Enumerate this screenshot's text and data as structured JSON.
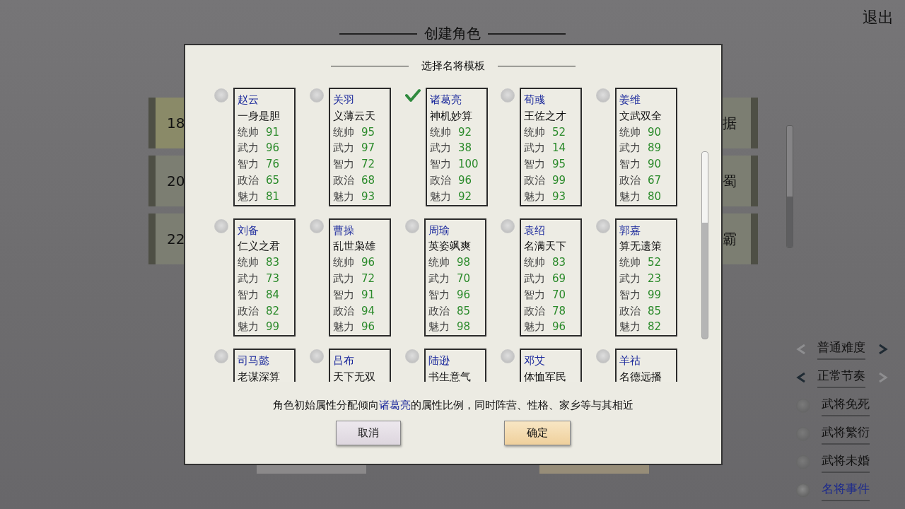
{
  "screen_title": "创建角色",
  "exit": "退出",
  "left_cards": [
    {
      "label": "18",
      "selected": true
    },
    {
      "label": "20",
      "selected": false
    },
    {
      "label": "22",
      "selected": false
    }
  ],
  "right_cards": [
    {
      "label": "据",
      "selected": false
    },
    {
      "label": "蜀",
      "selected": false
    },
    {
      "label": "霸",
      "selected": false
    }
  ],
  "settings": [
    {
      "kind": "stepper",
      "label": "普通难度",
      "prev_enabled": false,
      "next_enabled": true
    },
    {
      "kind": "stepper",
      "label": "正常节奏",
      "prev_enabled": true,
      "next_enabled": false
    },
    {
      "kind": "toggle",
      "label": "武将免死",
      "on": false
    },
    {
      "kind": "toggle",
      "label": "武将繁衍",
      "on": false
    },
    {
      "kind": "toggle",
      "label": "武将未婚",
      "on": false
    },
    {
      "kind": "toggle",
      "label": "名将事件",
      "on": true
    }
  ],
  "dialog": {
    "title": "选择名将模板",
    "generals": [
      {
        "name": "赵云",
        "motto": "一身是胆",
        "selected": false,
        "stats": [
          {
            "label": "统帅",
            "value": "91"
          },
          {
            "label": "武力",
            "value": "96"
          },
          {
            "label": "智力",
            "value": "76"
          },
          {
            "label": "政治",
            "value": "65"
          },
          {
            "label": "魅力",
            "value": "81"
          }
        ]
      },
      {
        "name": "关羽",
        "motto": "义薄云天",
        "selected": false,
        "stats": [
          {
            "label": "统帅",
            "value": "95"
          },
          {
            "label": "武力",
            "value": "97"
          },
          {
            "label": "智力",
            "value": "72"
          },
          {
            "label": "政治",
            "value": "68"
          },
          {
            "label": "魅力",
            "value": "93"
          }
        ]
      },
      {
        "name": "诸葛亮",
        "motto": "神机妙算",
        "selected": true,
        "stats": [
          {
            "label": "统帅",
            "value": "92"
          },
          {
            "label": "武力",
            "value": "38"
          },
          {
            "label": "智力",
            "value": "100"
          },
          {
            "label": "政治",
            "value": "96"
          },
          {
            "label": "魅力",
            "value": "92"
          }
        ]
      },
      {
        "name": "荀彧",
        "motto": "王佐之才",
        "selected": false,
        "stats": [
          {
            "label": "统帅",
            "value": "52"
          },
          {
            "label": "武力",
            "value": "14"
          },
          {
            "label": "智力",
            "value": "95"
          },
          {
            "label": "政治",
            "value": "99"
          },
          {
            "label": "魅力",
            "value": "93"
          }
        ]
      },
      {
        "name": "姜维",
        "motto": "文武双全",
        "selected": false,
        "stats": [
          {
            "label": "统帅",
            "value": "90"
          },
          {
            "label": "武力",
            "value": "89"
          },
          {
            "label": "智力",
            "value": "90"
          },
          {
            "label": "政治",
            "value": "67"
          },
          {
            "label": "魅力",
            "value": "80"
          }
        ]
      },
      {
        "name": "刘备",
        "motto": "仁义之君",
        "selected": false,
        "stats": [
          {
            "label": "统帅",
            "value": "83"
          },
          {
            "label": "武力",
            "value": "73"
          },
          {
            "label": "智力",
            "value": "84"
          },
          {
            "label": "政治",
            "value": "82"
          },
          {
            "label": "魅力",
            "value": "99"
          }
        ]
      },
      {
        "name": "曹操",
        "motto": "乱世枭雄",
        "selected": false,
        "stats": [
          {
            "label": "统帅",
            "value": "96"
          },
          {
            "label": "武力",
            "value": "72"
          },
          {
            "label": "智力",
            "value": "91"
          },
          {
            "label": "政治",
            "value": "94"
          },
          {
            "label": "魅力",
            "value": "96"
          }
        ]
      },
      {
        "name": "周瑜",
        "motto": "英姿飒爽",
        "selected": false,
        "stats": [
          {
            "label": "统帅",
            "value": "98"
          },
          {
            "label": "武力",
            "value": "70"
          },
          {
            "label": "智力",
            "value": "96"
          },
          {
            "label": "政治",
            "value": "85"
          },
          {
            "label": "魅力",
            "value": "98"
          }
        ]
      },
      {
        "name": "袁绍",
        "motto": "名满天下",
        "selected": false,
        "stats": [
          {
            "label": "统帅",
            "value": "83"
          },
          {
            "label": "武力",
            "value": "69"
          },
          {
            "label": "智力",
            "value": "70"
          },
          {
            "label": "政治",
            "value": "78"
          },
          {
            "label": "魅力",
            "value": "96"
          }
        ]
      },
      {
        "name": "郭嘉",
        "motto": "算无遗策",
        "selected": false,
        "stats": [
          {
            "label": "统帅",
            "value": "52"
          },
          {
            "label": "武力",
            "value": "23"
          },
          {
            "label": "智力",
            "value": "99"
          },
          {
            "label": "政治",
            "value": "85"
          },
          {
            "label": "魅力",
            "value": "82"
          }
        ]
      },
      {
        "name": "司马懿",
        "motto": "老谋深算",
        "selected": false
      },
      {
        "name": "吕布",
        "motto": "天下无双",
        "selected": false
      },
      {
        "name": "陆逊",
        "motto": "书生意气",
        "selected": false
      },
      {
        "name": "邓艾",
        "motto": "体恤军民",
        "selected": false
      },
      {
        "name": "羊祜",
        "motto": "名德远播",
        "selected": false
      }
    ],
    "note": {
      "before": "角色初始属性分配倾向",
      "highlight": "诸葛亮",
      "after": "的属性比例，同时阵营、性格、家乡等与其相近"
    },
    "buttons": [
      {
        "label": "取消",
        "kind": "cancel"
      },
      {
        "label": "确定",
        "kind": "confirm"
      }
    ]
  }
}
